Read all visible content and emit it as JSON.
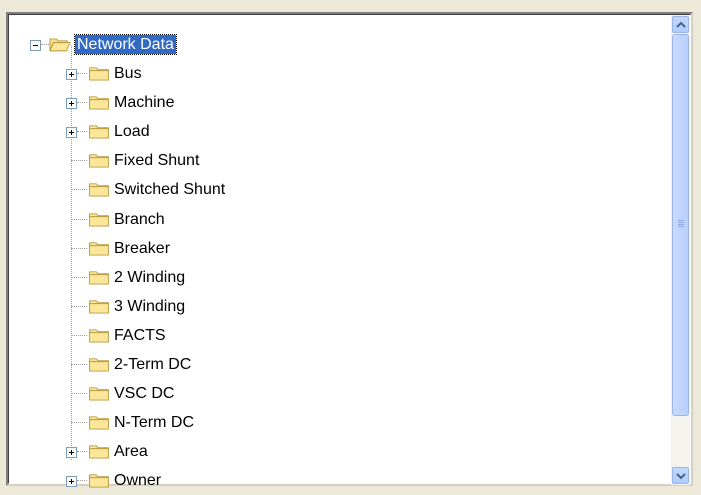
{
  "tree": {
    "root": {
      "label": "Network Data",
      "expanded": true,
      "selected": true
    },
    "items": [
      {
        "label": "Bus",
        "expandable": true
      },
      {
        "label": "Machine",
        "expandable": true
      },
      {
        "label": "Load",
        "expandable": true
      },
      {
        "label": "Fixed Shunt",
        "expandable": false
      },
      {
        "label": "Switched Shunt",
        "expandable": false
      },
      {
        "label": "Branch",
        "expandable": false
      },
      {
        "label": "Breaker",
        "expandable": false
      },
      {
        "label": "2 Winding",
        "expandable": false
      },
      {
        "label": "3 Winding",
        "expandable": false
      },
      {
        "label": "FACTS",
        "expandable": false
      },
      {
        "label": "2-Term DC",
        "expandable": false
      },
      {
        "label": "VSC DC",
        "expandable": false
      },
      {
        "label": "N-Term DC",
        "expandable": false
      },
      {
        "label": "Area",
        "expandable": true
      },
      {
        "label": "Owner",
        "expandable": true
      }
    ]
  },
  "icons": {
    "folder": "folder-icon",
    "folder_open": "folder-open-icon",
    "expand": "expand-plus-icon",
    "collapse": "collapse-minus-icon",
    "scroll_up": "scroll-up-arrow-icon",
    "scroll_down": "scroll-down-arrow-icon"
  },
  "colors": {
    "selection": "#316ac5",
    "folder_fill": "#fbe69a",
    "folder_stroke": "#b89a3e",
    "scrollbar": "#c2d8fe"
  }
}
